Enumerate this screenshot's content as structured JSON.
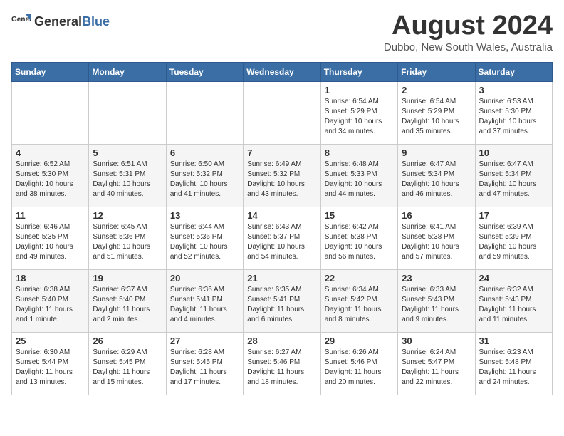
{
  "header": {
    "logo_general": "General",
    "logo_blue": "Blue",
    "title": "August 2024",
    "subtitle": "Dubbo, New South Wales, Australia"
  },
  "days_of_week": [
    "Sunday",
    "Monday",
    "Tuesday",
    "Wednesday",
    "Thursday",
    "Friday",
    "Saturday"
  ],
  "weeks": [
    [
      {
        "day": "",
        "info": ""
      },
      {
        "day": "",
        "info": ""
      },
      {
        "day": "",
        "info": ""
      },
      {
        "day": "",
        "info": ""
      },
      {
        "day": "1",
        "info": "Sunrise: 6:54 AM\nSunset: 5:29 PM\nDaylight: 10 hours\nand 34 minutes."
      },
      {
        "day": "2",
        "info": "Sunrise: 6:54 AM\nSunset: 5:29 PM\nDaylight: 10 hours\nand 35 minutes."
      },
      {
        "day": "3",
        "info": "Sunrise: 6:53 AM\nSunset: 5:30 PM\nDaylight: 10 hours\nand 37 minutes."
      }
    ],
    [
      {
        "day": "4",
        "info": "Sunrise: 6:52 AM\nSunset: 5:30 PM\nDaylight: 10 hours\nand 38 minutes."
      },
      {
        "day": "5",
        "info": "Sunrise: 6:51 AM\nSunset: 5:31 PM\nDaylight: 10 hours\nand 40 minutes."
      },
      {
        "day": "6",
        "info": "Sunrise: 6:50 AM\nSunset: 5:32 PM\nDaylight: 10 hours\nand 41 minutes."
      },
      {
        "day": "7",
        "info": "Sunrise: 6:49 AM\nSunset: 5:32 PM\nDaylight: 10 hours\nand 43 minutes."
      },
      {
        "day": "8",
        "info": "Sunrise: 6:48 AM\nSunset: 5:33 PM\nDaylight: 10 hours\nand 44 minutes."
      },
      {
        "day": "9",
        "info": "Sunrise: 6:47 AM\nSunset: 5:34 PM\nDaylight: 10 hours\nand 46 minutes."
      },
      {
        "day": "10",
        "info": "Sunrise: 6:47 AM\nSunset: 5:34 PM\nDaylight: 10 hours\nand 47 minutes."
      }
    ],
    [
      {
        "day": "11",
        "info": "Sunrise: 6:46 AM\nSunset: 5:35 PM\nDaylight: 10 hours\nand 49 minutes."
      },
      {
        "day": "12",
        "info": "Sunrise: 6:45 AM\nSunset: 5:36 PM\nDaylight: 10 hours\nand 51 minutes."
      },
      {
        "day": "13",
        "info": "Sunrise: 6:44 AM\nSunset: 5:36 PM\nDaylight: 10 hours\nand 52 minutes."
      },
      {
        "day": "14",
        "info": "Sunrise: 6:43 AM\nSunset: 5:37 PM\nDaylight: 10 hours\nand 54 minutes."
      },
      {
        "day": "15",
        "info": "Sunrise: 6:42 AM\nSunset: 5:38 PM\nDaylight: 10 hours\nand 56 minutes."
      },
      {
        "day": "16",
        "info": "Sunrise: 6:41 AM\nSunset: 5:38 PM\nDaylight: 10 hours\nand 57 minutes."
      },
      {
        "day": "17",
        "info": "Sunrise: 6:39 AM\nSunset: 5:39 PM\nDaylight: 10 hours\nand 59 minutes."
      }
    ],
    [
      {
        "day": "18",
        "info": "Sunrise: 6:38 AM\nSunset: 5:40 PM\nDaylight: 11 hours\nand 1 minute."
      },
      {
        "day": "19",
        "info": "Sunrise: 6:37 AM\nSunset: 5:40 PM\nDaylight: 11 hours\nand 2 minutes."
      },
      {
        "day": "20",
        "info": "Sunrise: 6:36 AM\nSunset: 5:41 PM\nDaylight: 11 hours\nand 4 minutes."
      },
      {
        "day": "21",
        "info": "Sunrise: 6:35 AM\nSunset: 5:41 PM\nDaylight: 11 hours\nand 6 minutes."
      },
      {
        "day": "22",
        "info": "Sunrise: 6:34 AM\nSunset: 5:42 PM\nDaylight: 11 hours\nand 8 minutes."
      },
      {
        "day": "23",
        "info": "Sunrise: 6:33 AM\nSunset: 5:43 PM\nDaylight: 11 hours\nand 9 minutes."
      },
      {
        "day": "24",
        "info": "Sunrise: 6:32 AM\nSunset: 5:43 PM\nDaylight: 11 hours\nand 11 minutes."
      }
    ],
    [
      {
        "day": "25",
        "info": "Sunrise: 6:30 AM\nSunset: 5:44 PM\nDaylight: 11 hours\nand 13 minutes."
      },
      {
        "day": "26",
        "info": "Sunrise: 6:29 AM\nSunset: 5:45 PM\nDaylight: 11 hours\nand 15 minutes."
      },
      {
        "day": "27",
        "info": "Sunrise: 6:28 AM\nSunset: 5:45 PM\nDaylight: 11 hours\nand 17 minutes."
      },
      {
        "day": "28",
        "info": "Sunrise: 6:27 AM\nSunset: 5:46 PM\nDaylight: 11 hours\nand 18 minutes."
      },
      {
        "day": "29",
        "info": "Sunrise: 6:26 AM\nSunset: 5:46 PM\nDaylight: 11 hours\nand 20 minutes."
      },
      {
        "day": "30",
        "info": "Sunrise: 6:24 AM\nSunset: 5:47 PM\nDaylight: 11 hours\nand 22 minutes."
      },
      {
        "day": "31",
        "info": "Sunrise: 6:23 AM\nSunset: 5:48 PM\nDaylight: 11 hours\nand 24 minutes."
      }
    ]
  ]
}
